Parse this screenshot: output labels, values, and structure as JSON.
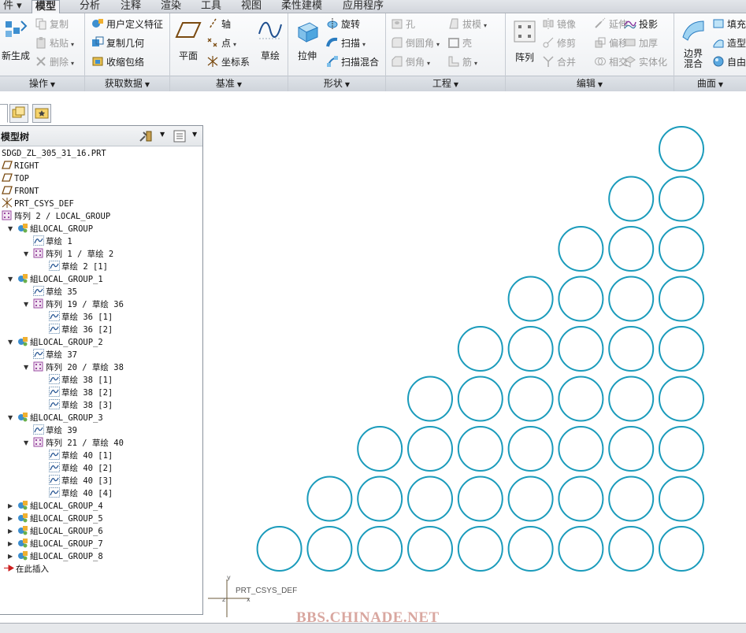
{
  "menu": {
    "tabs": [
      {
        "label": "件 ▾"
      },
      {
        "label": "模型"
      },
      {
        "label": "分析"
      },
      {
        "label": "注释"
      },
      {
        "label": "渲染"
      },
      {
        "label": "工具"
      },
      {
        "label": "视图"
      },
      {
        "label": "柔性建模"
      },
      {
        "label": "应用程序"
      }
    ],
    "active": "模型"
  },
  "ribbon": {
    "groups": {
      "operations": {
        "label": "操作",
        "regenerate": "新生成",
        "copy": "复制",
        "paste": "粘贴",
        "delete": "删除"
      },
      "get_data": {
        "label": "获取数据",
        "udf": "用户定义特征",
        "copy_geom": "复制几何",
        "shrinkwrap": "收缩包络"
      },
      "datum": {
        "label": "基准",
        "plane": "平面",
        "axis": "轴",
        "point": "点",
        "csys": "坐标系",
        "sketch": "草绘"
      },
      "shapes": {
        "label": "形状",
        "extrude": "拉伸",
        "revolve": "旋转",
        "sweep": "扫描",
        "swept_blend": "扫描混合"
      },
      "engineering": {
        "label": "工程",
        "hole": "孔",
        "draft": "拔模",
        "round": "倒圆角",
        "shell": "壳",
        "chamfer": "倒角",
        "rib": "筋"
      },
      "editing": {
        "label": "编辑",
        "pattern": "阵列",
        "mirror": "镜像",
        "extend": "延伸",
        "project": "投影",
        "trim": "修剪",
        "offset": "偏移",
        "thicken": "加厚",
        "merge": "合并",
        "intersect": "相交",
        "solidify": "实体化"
      },
      "surfaces": {
        "label": "曲面",
        "boundary_blend": "边界混合",
        "fill": "填充",
        "style": "造型",
        "freestyle": "自由"
      }
    }
  },
  "model_tree": {
    "title": "模型树",
    "rows": [
      {
        "text": "SDGD_ZL_305_31_16.PRT",
        "icon": "part-icon"
      },
      {
        "text": "RIGHT",
        "icon": "datum-plane-icon"
      },
      {
        "text": "TOP",
        "icon": "datum-plane-icon"
      },
      {
        "text": "FRONT",
        "icon": "datum-plane-icon"
      },
      {
        "text": "PRT_CSYS_DEF",
        "icon": "csys-icon"
      },
      {
        "text": "阵列 2 / LOCAL_GROUP",
        "icon": "pattern-icon"
      },
      {
        "text": "組LOCAL_GROUP",
        "icon": "group-icon",
        "expand": "▼"
      },
      {
        "text": "草绘 1",
        "icon": "sketch-icon"
      },
      {
        "text": "阵列 1 / 草绘 2",
        "icon": "pattern-icon",
        "expand": "▼"
      },
      {
        "text": "草绘 2 [1]",
        "icon": "sketch-icon"
      },
      {
        "text": "組LOCAL_GROUP_1",
        "icon": "group-icon",
        "expand": "▼"
      },
      {
        "text": "草绘 35",
        "icon": "sketch-icon"
      },
      {
        "text": "阵列 19 / 草绘 36",
        "icon": "pattern-icon",
        "expand": "▼"
      },
      {
        "text": "草绘 36 [1]",
        "icon": "sketch-icon"
      },
      {
        "text": "草绘 36 [2]",
        "icon": "sketch-icon"
      },
      {
        "text": "組LOCAL_GROUP_2",
        "icon": "group-icon",
        "expand": "▼"
      },
      {
        "text": "草绘 37",
        "icon": "sketch-icon"
      },
      {
        "text": "阵列 20 / 草绘 38",
        "icon": "pattern-icon",
        "expand": "▼"
      },
      {
        "text": "草绘 38 [1]",
        "icon": "sketch-icon"
      },
      {
        "text": "草绘 38 [2]",
        "icon": "sketch-icon"
      },
      {
        "text": "草绘 38 [3]",
        "icon": "sketch-icon"
      },
      {
        "text": "組LOCAL_GROUP_3",
        "icon": "group-icon",
        "expand": "▼"
      },
      {
        "text": "草绘 39",
        "icon": "sketch-icon"
      },
      {
        "text": "阵列 21 / 草绘 40",
        "icon": "pattern-icon",
        "expand": "▼"
      },
      {
        "text": "草绘 40 [1]",
        "icon": "sketch-icon"
      },
      {
        "text": "草绘 40 [2]",
        "icon": "sketch-icon"
      },
      {
        "text": "草绘 40 [3]",
        "icon": "sketch-icon"
      },
      {
        "text": "草绘 40 [4]",
        "icon": "sketch-icon"
      },
      {
        "text": "組LOCAL_GROUP_4",
        "icon": "group-icon",
        "expand": "▶"
      },
      {
        "text": "組LOCAL_GROUP_5",
        "icon": "group-icon",
        "expand": "▶"
      },
      {
        "text": "組LOCAL_GROUP_6",
        "icon": "group-icon",
        "expand": "▶"
      },
      {
        "text": "組LOCAL_GROUP_7",
        "icon": "group-icon",
        "expand": "▶"
      },
      {
        "text": "組LOCAL_GROUP_8",
        "icon": "group-icon",
        "expand": "▶"
      },
      {
        "text": "在此插入",
        "icon": "insert-here-icon"
      }
    ]
  },
  "graphics": {
    "csys_label": "PRT_CSYS_DEF",
    "axis_x": "x",
    "axis_y": "y",
    "axis_z": "z",
    "circle_color": "#1a9bbb",
    "circle_rows": [
      9,
      8,
      7,
      6,
      5,
      4,
      3,
      2,
      1
    ]
  },
  "watermark": "BBS.CHINADE.NET",
  "colors": {
    "circle": "#1a9bbb",
    "insert_arrow": "#cc1f1f",
    "watermark": "#d9a7a0"
  }
}
